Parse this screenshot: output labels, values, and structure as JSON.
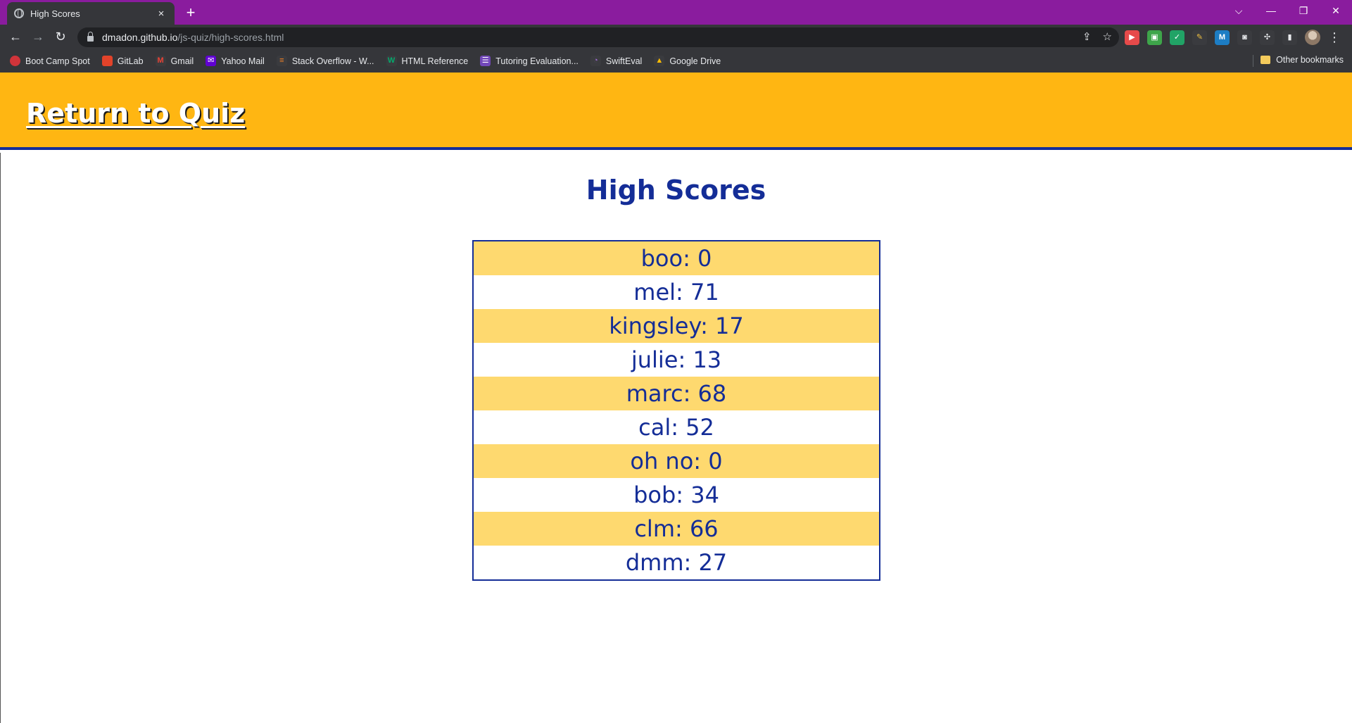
{
  "browser": {
    "tab": {
      "title": "High Scores",
      "close": "×"
    },
    "new_tab": "+",
    "window_controls": {
      "tab_search": "⌵",
      "minimize": "—",
      "restore": "❐",
      "close": "✕"
    },
    "nav": {
      "back": "←",
      "forward": "→",
      "reload": "↻"
    },
    "url": {
      "host": "dmadon.github.io",
      "path": "/js-quiz/high-scores.html"
    },
    "omnibox_icons": {
      "share": "⇪",
      "star": "☆"
    },
    "bookmarks": [
      {
        "label": "Boot Camp Spot",
        "icon": "bootcamp-icon",
        "color": "#d0343a"
      },
      {
        "label": "GitLab",
        "icon": "gitlab-icon",
        "color": "#e2432a"
      },
      {
        "label": "Gmail",
        "icon": "gmail-icon",
        "color": "#ea4335"
      },
      {
        "label": "Yahoo Mail",
        "icon": "yahoo-icon",
        "color": "#6001d2"
      },
      {
        "label": "Stack Overflow - W...",
        "icon": "stackoverflow-icon",
        "color": "#f48024"
      },
      {
        "label": "HTML Reference",
        "icon": "w3-icon",
        "color": "#04aa6d"
      },
      {
        "label": "Tutoring Evaluation...",
        "icon": "forms-icon",
        "color": "#7248b9"
      },
      {
        "label": "SwiftEval",
        "icon": "swifteval-icon",
        "color": "#a06cd5"
      },
      {
        "label": "Google Drive",
        "icon": "drive-icon",
        "color": "#1fa463"
      }
    ],
    "other_bookmarks": "Other bookmarks",
    "menu": "⋮"
  },
  "header": {
    "return_link": "Return to Quiz",
    "background_color": "#ffb612",
    "border_color": "#142d97"
  },
  "main": {
    "title": "High Scores",
    "scores": [
      "boo: 0",
      "mel: 71",
      "kingsley: 17",
      "julie: 13",
      "marc: 68",
      "cal: 52",
      "oh no: 0",
      "bob: 34",
      "clm: 66",
      "dmm: 27"
    ],
    "row_colors": {
      "odd": "#fed96f",
      "even": "#ffffff",
      "text": "#142d97"
    }
  }
}
